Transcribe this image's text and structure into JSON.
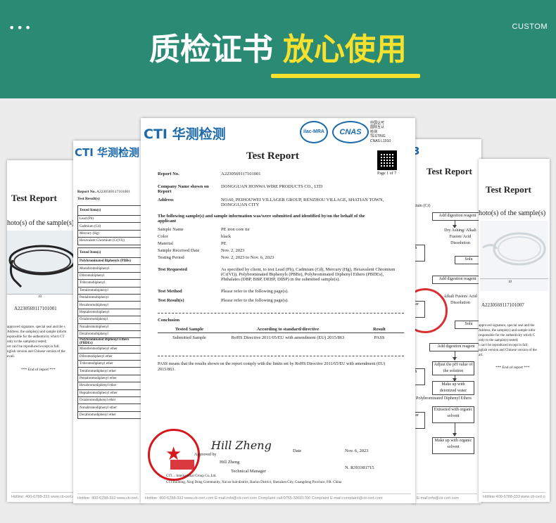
{
  "banner": {
    "dots": "•••",
    "custom": "CUSTOM",
    "title_white": "质检证书",
    "title_yellow": "放心使用"
  },
  "colors": {
    "banner": "#2a8a73",
    "accent": "#f5e12e",
    "logo_blue": "#1d6aaa",
    "stamp_red": "#d4181d"
  },
  "doc_far_left": {
    "heading": "Test Report",
    "caption": "hoto(s) of the sample(s)",
    "ruler_mark": "10",
    "sample_id": "A2230569117101001",
    "lines": [
      "approved signature, special seal and the s",
      "Address, the sample(s) and sample inform",
      "esponsible for the authenticity which CT",
      "only to the sample(s) tested;",
      "ort can't be reproduced except in full;",
      "nglish version and Chinese version of the",
      "evail."
    ],
    "end": "*** End of report ***",
    "footer": "Hotline: 400-6788-333    www.cti-cert.com    Complaint call:0755-3368"
  },
  "doc_left": {
    "logo": "CTI 华测检测",
    "report_no_label": "Report No.",
    "report_no": "A2230569117101001",
    "test_results_label": "Test Result(s)",
    "tested_items": "Tested Item(s)",
    "items_a": [
      "Lead (Pb)",
      "Cadmium (Cd)",
      "Mercury (Hg)",
      "Hexavalent Chromium (Cr(VI))"
    ],
    "tested_items_2": "Tested Item(s)",
    "pbb_head": "Polybrominated Biphenyls (PBBs)",
    "pbb": [
      "Monobromobiphenyl",
      "Dibromobiphenyl",
      "Tribromobiphenyl",
      "Tetrabromobiphenyl",
      "Pentabromobiphenyl",
      "Hexabromobiphenyl",
      "Heptabromobiphenyl",
      "Octabromobiphenyl",
      "Nonabromobiphenyl",
      "Decabromobiphenyl"
    ],
    "pbde_head": "Polybrominated Diphenyl Ethers (PBDEs)",
    "pbde": [
      "Monobromodiphenyl ether",
      "Dibromodiphenyl ether",
      "Tribromodiphenyl ether",
      "Tetrabromodiphenyl ether",
      "Pentabromodiphenyl ether",
      "Hexabromodiphenyl ether",
      "Heptabromodiphenyl ether",
      "Octabromodiphenyl ether",
      "Nonabromodiphenyl ether",
      "Decabromodiphenyl ether"
    ],
    "footer": "Hotline: 400-6788-333    www.cti-cert.com"
  },
  "doc_center": {
    "logo": "CTI 华测检测",
    "ilac": "ilac-MRA",
    "cnas": "CNAS",
    "cnas_lines": [
      "中国认可",
      "国际互认",
      "检测",
      "TESTING",
      "CNAS L1910"
    ],
    "heading": "Test Report",
    "page": "Page 1 of 7",
    "report_no_label": "Report No.",
    "report_no": "A2230569117101001",
    "company_label": "Company Name shown on Report",
    "company": "DONGGUAN HONWA WIRE PRODUCTS CO., LTD",
    "address_label": "Address",
    "address": "NO.60, PEIHOUWEI VILLAGER GROUP, RENZHOU VILLAGE, SHATIAN TOWN, DONGGUAN CITY",
    "intro": "The following sample(s) and sample information was/were submitted and identified by/on the behalf of the applicant",
    "fields": [
      {
        "label": "Sample Name",
        "value": "PE iron core tie"
      },
      {
        "label": "Color",
        "value": "black"
      },
      {
        "label": "Material",
        "value": "PE"
      },
      {
        "label": "Sample Received Date",
        "value": "Nov. 2, 2023"
      },
      {
        "label": "Testing Period",
        "value": "Nov. 2, 2023 to Nov. 6, 2023"
      }
    ],
    "requested_label": "Test Requested",
    "requested": "As specified by client, to test Lead (Pb), Cadmium (Cd), Mercury (Hg), Hexavalent Chromium (Cr(VI)), Polybrominated Biphenyls (PBBs), Polybrominated Diphenyl Ethers (PBDEs), Phthalates (DBP, BBP, DEHP, DIBP) in the submitted sample(s).",
    "method_label": "Test Method",
    "method": "Please refer to the following page(s).",
    "results_label": "Test Result(s)",
    "results": "Please refer to the following page(s).",
    "conclusion": "Conclusion",
    "table_head": [
      "Tested Sample",
      "According to standard/directive",
      "Result"
    ],
    "table_row": [
      "Submitted Sample",
      "RoHS Directive 2011/65/EU with amendment (EU) 2015/863",
      "PASS"
    ],
    "pass_note": "PASS means that the results shown on the report comply with the limits set by RoHS Directive 2011/65/EU with amendment (EU) 2015/863.",
    "signature": "Hill Zheng",
    "approved": "Approved by",
    "date_label": "Date",
    "date": "Nov. 6, 2023",
    "signer": "Hill Zheng",
    "title": "Technical Manager",
    "rno": "N. R393381715",
    "company_footer": "CTI ... International Group Co.,Ltd.",
    "addr_footer": "CTI Building, Xing Dong Community, Xin'an Sub-district, Bao'an District, Shenzhen City, Guangdong Province, P.R. China",
    "footer": "Hotline: 400-6788-333    www.cti-cert.com    E-mail:info@cti-cert.com    Complaint call:0755-33681700    Complaint E-mail:complaint@cti-cert.com"
  },
  "doc_right": {
    "logo": "3",
    "heading": "Test Report",
    "cr_label": "mium (Cr)",
    "flow": [
      "Add digestion reagent",
      "Dry Ashing/ Alkali Fusion/ Acid Dissolution",
      "Solu",
      "Add digestion reagent",
      "Alkali Fusion/ Acid Dissolution",
      "Solu",
      "Add digestion reagent",
      "Adjust the pH value of the solution",
      "Make up with deionized water",
      "Extracted with organic solvent",
      "Make up with organic solvent"
    ],
    "side": [
      "ith",
      "ater",
      "ith",
      "ater"
    ],
    "pbde_label": "), Polybrominated Diphenyl Ethers",
    "footer": "E-mail:info@cti-cert.com"
  },
  "doc_far_right": {
    "heading": "Test Report",
    "caption": "hoto(s) of the sample(s)",
    "ruler_mark": "10",
    "sample_id": "A2230569117101007",
    "lines": [
      "approved signature, special seal and the",
      "Address, the sample(s) and sample infor",
      "responsible for the authenticity which C",
      "only to the sample(s) tested;",
      "t can't be reproduced except in full;",
      "nglish version and Chinese version of the",
      "ail."
    ],
    "end": "*** End of report ***",
    "footer": "Hotline:400-6788-333  www.cti-cert.com"
  }
}
